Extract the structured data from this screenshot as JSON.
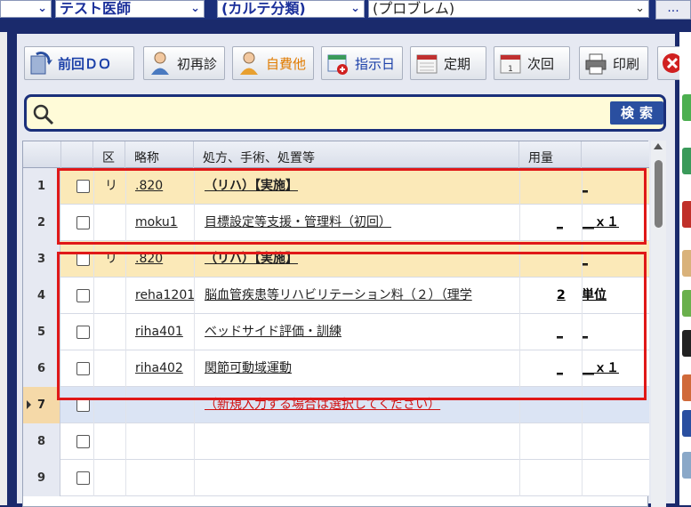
{
  "selectors": {
    "doctor": "テスト医師",
    "category": "(カルテ分類)",
    "problem": "(プロブレム)",
    "more": "..."
  },
  "toolbar": {
    "prev_do": "前回ＤＯ",
    "first_visit": "初再診",
    "self_pay": "自費他",
    "instruction_day": "指示日",
    "regular": "定期",
    "next": "次回",
    "print": "印刷"
  },
  "search": {
    "placeholder": "",
    "button": "検索"
  },
  "grid": {
    "headers": [
      "区",
      "略称",
      "処方、手術、処置等",
      "用量"
    ],
    "rows": [
      {
        "no": "1",
        "style": "yellow",
        "ku": "リ",
        "ryaku": ".820",
        "name": "（リハ）【実施】",
        "bold": true,
        "amount": "",
        "unit": "_"
      },
      {
        "no": "2",
        "style": "white",
        "ku": "",
        "ryaku": "moku1",
        "name": "目標設定等支援・管理料（初回）",
        "bold": false,
        "amount": "_",
        "unit": "__ｘ１"
      },
      {
        "no": "3",
        "style": "yellow",
        "ku": "リ",
        "ryaku": ".820",
        "name": "（リハ）【実施】",
        "bold": true,
        "amount": "",
        "unit": "_"
      },
      {
        "no": "4",
        "style": "white",
        "ku": "",
        "ryaku": "reha1201",
        "name": "脳血管疾患等リハビリテーション料（２）（理学",
        "bold": false,
        "amount": "2",
        "unit": "単位"
      },
      {
        "no": "5",
        "style": "white",
        "ku": "",
        "ryaku": "riha401",
        "name": "ベッドサイド評価・訓練",
        "bold": false,
        "amount": "_",
        "unit": "_"
      },
      {
        "no": "6",
        "style": "white",
        "ku": "",
        "ryaku": "riha402",
        "name": "関節可動域運動",
        "bold": false,
        "amount": "_",
        "unit": "__ｘ１"
      },
      {
        "no": "7",
        "style": "blue",
        "ku": "",
        "ryaku": "",
        "name": "（新規入力する場合は選択してください）",
        "bold": false,
        "amount": "",
        "unit": ""
      },
      {
        "no": "8",
        "style": "white",
        "ku": "",
        "ryaku": "",
        "name": "",
        "bold": false,
        "amount": "",
        "unit": ""
      },
      {
        "no": "9",
        "style": "white",
        "ku": "",
        "ryaku": "",
        "name": "",
        "bold": false,
        "amount": "",
        "unit": ""
      }
    ]
  },
  "colors": {
    "accent": "#1a2f7a",
    "highlight": "#e01818",
    "yellow_row": "#fbe9b8"
  }
}
